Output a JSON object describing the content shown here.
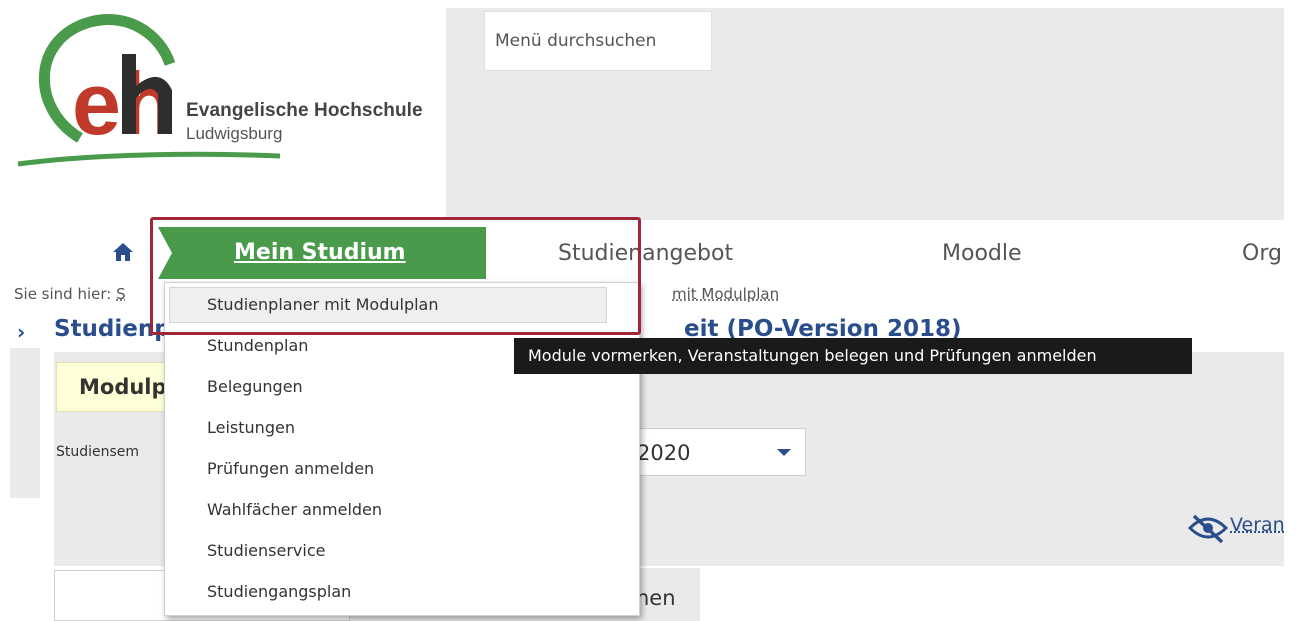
{
  "logo": {
    "letters": "eh",
    "name": "Evangelische Hochschule",
    "city": "Ludwigsburg"
  },
  "search": {
    "label": "Menü durchsuchen"
  },
  "nav": {
    "home_icon": "home-icon",
    "items": [
      {
        "label": "Mein Studium",
        "active": true
      },
      {
        "label": "Studienangebot"
      },
      {
        "label": "Moodle"
      },
      {
        "label": "Org"
      }
    ]
  },
  "breadcrumb": {
    "prefix": "Sie sind hier:",
    "link_start": "S",
    "link_end": "mit Modulplan"
  },
  "page": {
    "title_start": "Studienp",
    "title_end": "eit (PO-Version 2018)",
    "tab_label": "Modulp",
    "semester_label": "Studiensem",
    "semester_value": "2020",
    "toggle_link": "Veran",
    "bottom_tab_label": "hen"
  },
  "dropdown": {
    "items": [
      "Studienplaner mit Modulplan",
      "Stundenplan",
      "Belegungen",
      "Leistungen",
      "Prüfungen anmelden",
      "Wahlfächer anmelden",
      "Studienservice",
      "Studiengangsplan"
    ]
  },
  "tooltip": {
    "text": "Module vormerken, Veranstaltungen belegen und Prüfungen anmelden"
  },
  "colors": {
    "brand_green": "#4a9a4c",
    "brand_red": "#c0392b",
    "link_blue": "#2a4e8c",
    "highlight_red": "#a32638"
  }
}
